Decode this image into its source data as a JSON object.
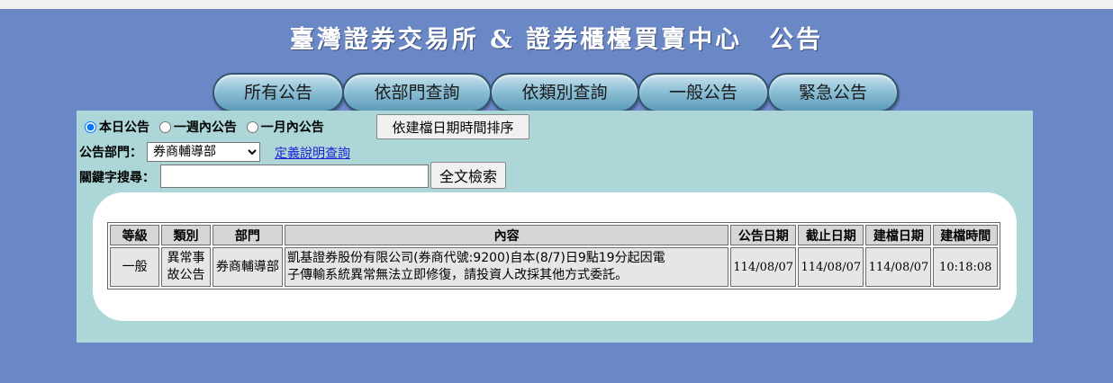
{
  "header": {
    "title": "臺灣證券交易所 & 證券櫃檯買賣中心　公告"
  },
  "tabs": [
    {
      "label": "所有公告"
    },
    {
      "label": "依部門查詢"
    },
    {
      "label": "依類別查詢"
    },
    {
      "label": "一般公告"
    },
    {
      "label": "緊急公告"
    }
  ],
  "filters": {
    "period_options": [
      {
        "label": "本日公告",
        "checked": true
      },
      {
        "label": "一週內公告",
        "checked": false
      },
      {
        "label": "一月內公告",
        "checked": false
      }
    ],
    "sort_button": "依建檔日期時間排序",
    "dept_label": "公告部門：",
    "dept_value": "券商輔導部",
    "definition_link": "定義說明查詢",
    "keyword_label": "關鍵字搜尋：",
    "keyword_value": "",
    "search_button": "全文檢索"
  },
  "table": {
    "headers": [
      "等級",
      "類別",
      "部門",
      "內容",
      "公告日期",
      "截止日期",
      "建檔日期",
      "建檔時間"
    ],
    "rows": [
      {
        "level": "一般",
        "category_line1": "異常事",
        "category_line2": "故公告",
        "department": "券商輔導部",
        "content_line1": "凱基證券股份有限公司(券商代號:9200)自本(8/7)日9點19分起因電",
        "content_line2": "子傳輸系統異常無法立即修復，請投資人改採其他方式委託。",
        "announce_date": "114/08/07",
        "deadline_date": "114/08/07",
        "created_date": "114/08/07",
        "created_time": "10:18:08"
      }
    ]
  },
  "colors": {
    "page_background": "#6a87c6",
    "panel_background": "#acd6d7",
    "link": "#1f1fd6"
  }
}
